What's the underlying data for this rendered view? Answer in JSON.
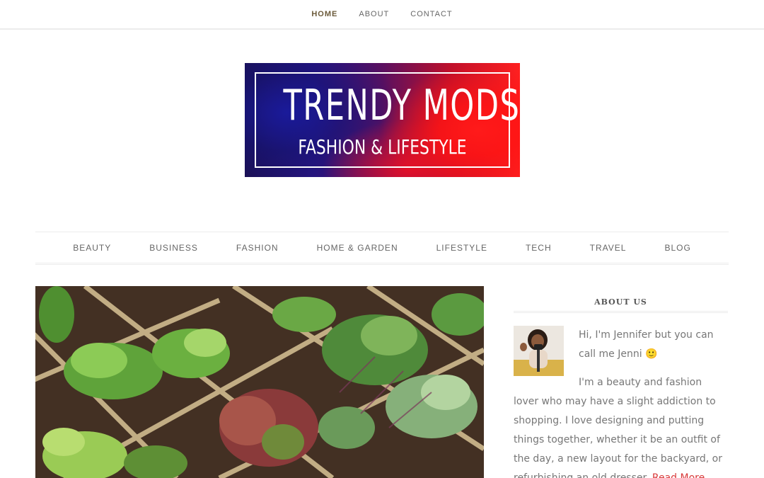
{
  "top_nav": {
    "items": [
      {
        "label": "HOME",
        "active": true
      },
      {
        "label": "ABOUT",
        "active": false
      },
      {
        "label": "CONTACT",
        "active": false
      }
    ]
  },
  "logo": {
    "title": "TRENDY MODS",
    "subtitle": "FASHION & LIFESTYLE"
  },
  "category_nav": {
    "items": [
      "BEAUTY",
      "BUSINESS",
      "FASHION",
      "HOME & GARDEN",
      "LIFESTYLE",
      "TECH",
      "TRAVEL",
      "BLOG"
    ]
  },
  "sidebar": {
    "about_widget": {
      "title": "ABOUT US",
      "intro": "Hi, I'm Jennifer but you can call me Jenni",
      "emoji": "🙂",
      "body": "I'm a beauty and fashion lover who may have a slight addiction to shopping. I love designing and putting things together, whether it be an outfit of the day, a new layout for the backyard, or refurbishing an old dresser.",
      "read_more": "Read More"
    }
  },
  "colors": {
    "accent": "#d93b3b",
    "active_nav": "#6b5a3a"
  }
}
